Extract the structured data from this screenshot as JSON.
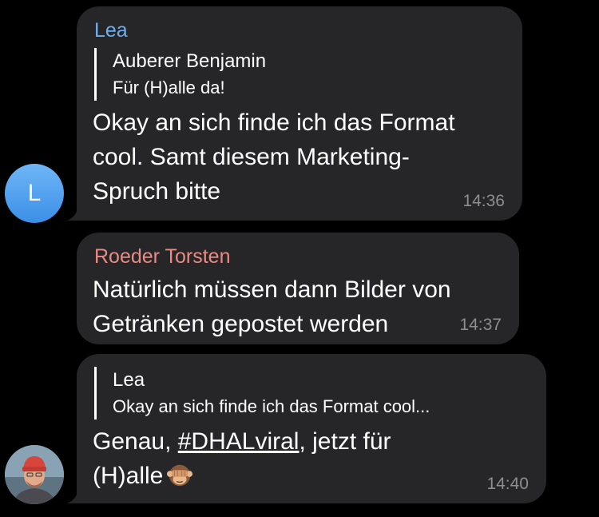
{
  "messages": [
    {
      "sender": "Lea",
      "reply": {
        "author": "Auberer Benjamin",
        "text": "Für (H)alle da!"
      },
      "text": "Okay an sich finde ich das Format cool. Samt diesem Marketing-Spruch bitte",
      "lines": [
        "Okay an sich finde ich das Format",
        "cool. Samt diesem Marketing-",
        "Spruch bitte"
      ],
      "time": "14:36"
    },
    {
      "sender": "Roeder Torsten",
      "lines": [
        "Natürlich müssen dann Bilder von",
        "Getränken gepostet werden"
      ],
      "time": "14:37"
    },
    {
      "reply": {
        "author": "Lea",
        "text": "Okay an sich finde ich das Format cool..."
      },
      "text_parts": {
        "prefix": "Genau, ",
        "hashtag": "#DHALviral",
        "suffix": ", jetzt für",
        "line2": "(H)alle"
      },
      "emoji": "see-no-evil-monkey",
      "time": "14:40"
    }
  ],
  "avatars": {
    "lea_letter": "L",
    "colors": {
      "lea_avatar": "#4d9eeb",
      "bubble": "#262628",
      "sender_blue": "#6cb0f0",
      "sender_red": "#e98a85",
      "timestamp": "#8d8d92"
    }
  }
}
